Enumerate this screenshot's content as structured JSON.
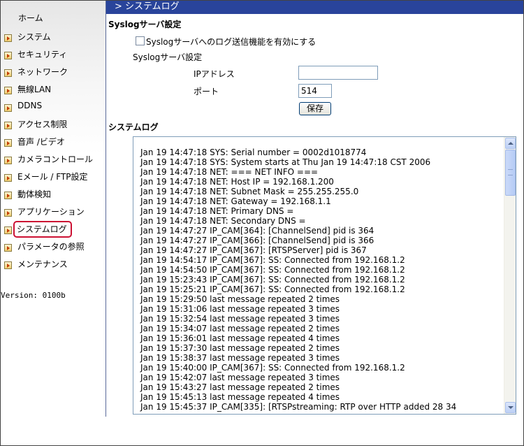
{
  "sidebar": {
    "home": "ホーム",
    "items": [
      {
        "label": "システム"
      },
      {
        "label": "セキュリティ"
      },
      {
        "label": "ネットワーク"
      },
      {
        "label": "無線LAN"
      },
      {
        "label": "DDNS"
      },
      {
        "label": "アクセス制限"
      },
      {
        "label": "音声 /ビデオ"
      },
      {
        "label": "カメラコントロール"
      },
      {
        "label": "Eメール / FTP設定"
      },
      {
        "label": "動体検知"
      },
      {
        "label": "アプリケーション"
      },
      {
        "label": "システムログ",
        "active": true
      },
      {
        "label": "パラメータの参照"
      },
      {
        "label": "メンテナンス"
      }
    ],
    "version": "Version: 0100b"
  },
  "header": {
    "title": "> システムログ"
  },
  "syslog": {
    "section_title": "Syslogサーバ設定",
    "enable_label": "Syslogサーバへのログ送信機能を有効にする",
    "enable_checked": false,
    "server_label": "Syslogサーバ設定",
    "ip_label": "IPアドレス",
    "ip_value": "",
    "port_label": "ポート",
    "port_value": "514",
    "save_label": "保存"
  },
  "log": {
    "section_title": "システムログ",
    "lines": [
      "Jan 19 14:47:18 SYS: Serial number = 0002d1018774",
      "Jan 19 14:47:18 SYS: System starts at Thu Jan 19 14:47:18 CST 2006",
      "Jan 19 14:47:18 NET: === NET INFO ===",
      "Jan 19 14:47:18 NET: Host IP = 192.168.1.200",
      "Jan 19 14:47:18 NET: Subnet Mask = 255.255.255.0",
      "Jan 19 14:47:18 NET: Gateway = 192.168.1.1",
      "Jan 19 14:47:18 NET: Primary DNS =",
      "Jan 19 14:47:18 NET: Secondary DNS =",
      "Jan 19 14:47:27 IP_CAM[364]: [ChannelSend] pid is 364",
      "Jan 19 14:47:27 IP_CAM[366]: [ChannelSend] pid is 366",
      "Jan 19 14:47:27 IP_CAM[367]: [RTSPServer] pid is 367",
      "Jan 19 14:54:17 IP_CAM[367]: SS: Connected from 192.168.1.2",
      "Jan 19 14:54:50 IP_CAM[367]: SS: Connected from 192.168.1.2",
      "Jan 19 15:23:43 IP_CAM[367]: SS: Connected from 192.168.1.2",
      "Jan 19 15:25:21 IP_CAM[367]: SS: Connected from 192.168.1.2",
      "Jan 19 15:29:50 last message repeated 2 times",
      "Jan 19 15:31:06 last message repeated 3 times",
      "Jan 19 15:32:54 last message repeated 3 times",
      "Jan 19 15:34:07 last message repeated 2 times",
      "Jan 19 15:36:01 last message repeated 4 times",
      "Jan 19 15:37:30 last message repeated 2 times",
      "Jan 19 15:38:37 last message repeated 3 times",
      "Jan 19 15:40:00 IP_CAM[367]: SS: Connected from 192.168.1.2",
      "Jan 19 15:42:07 last message repeated 3 times",
      "Jan 19 15:43:27 last message repeated 2 times",
      "Jan 19 15:45:13 last message repeated 4 times",
      "Jan 19 15:45:37 IP_CAM[335]: [RTSPstreaming: RTP over HTTP added 28 34"
    ]
  },
  "colors": {
    "titlebar": "#29449b",
    "active_highlight": "#cc1133"
  }
}
